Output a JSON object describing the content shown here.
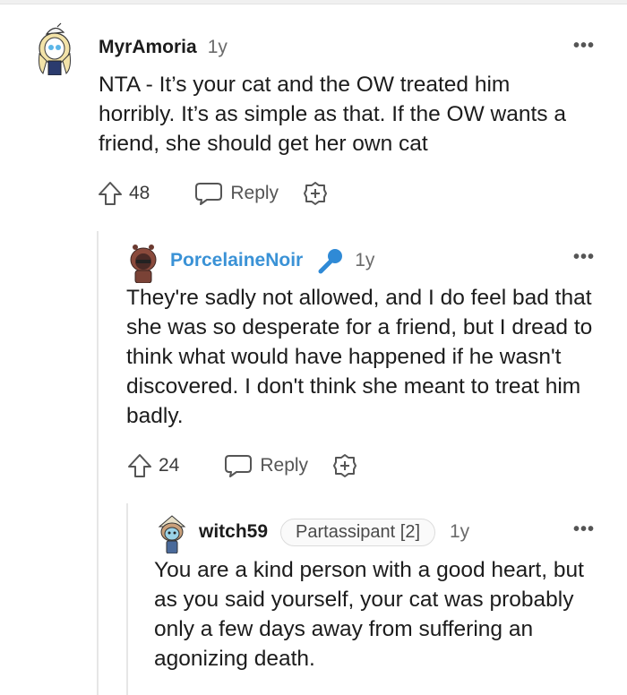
{
  "comments": [
    {
      "username": "MyrAmoria",
      "age": "1y",
      "more": "•••",
      "body": "NTA - It’s your cat and the OW treated him horribly. It’s as simple as that. If the OW wants a friend, she should get her own cat",
      "votes": "48",
      "reply_label": "Reply"
    },
    {
      "username": "PorcelaineNoir",
      "age": "1y",
      "more": "•••",
      "body": "They're sadly not allowed, and I do feel bad that she was so desperate for a friend, but I dread to think what would have happened if he wasn't discovered. I don't think she meant to treat him badly.",
      "votes": "24",
      "reply_label": "Reply"
    },
    {
      "username": "witch59",
      "flair": "Partassipant [2]",
      "age": "1y",
      "more": "•••",
      "body": "You are a kind person with a good heart, but as you said yourself, your cat was probably only a few days away from suffering an agonizing death."
    }
  ],
  "colors": {
    "op_username": "#3a92d6",
    "text": "#1c1c1c",
    "muted": "#6b6b6b",
    "thread_line": "#e6e6e6"
  },
  "icons": {
    "upvote": "upvote-arrow-icon",
    "reply": "speech-bubble-icon",
    "award": "plus-circle-icon",
    "op_badge": "microphone-icon",
    "more": "ellipsis-icon"
  }
}
